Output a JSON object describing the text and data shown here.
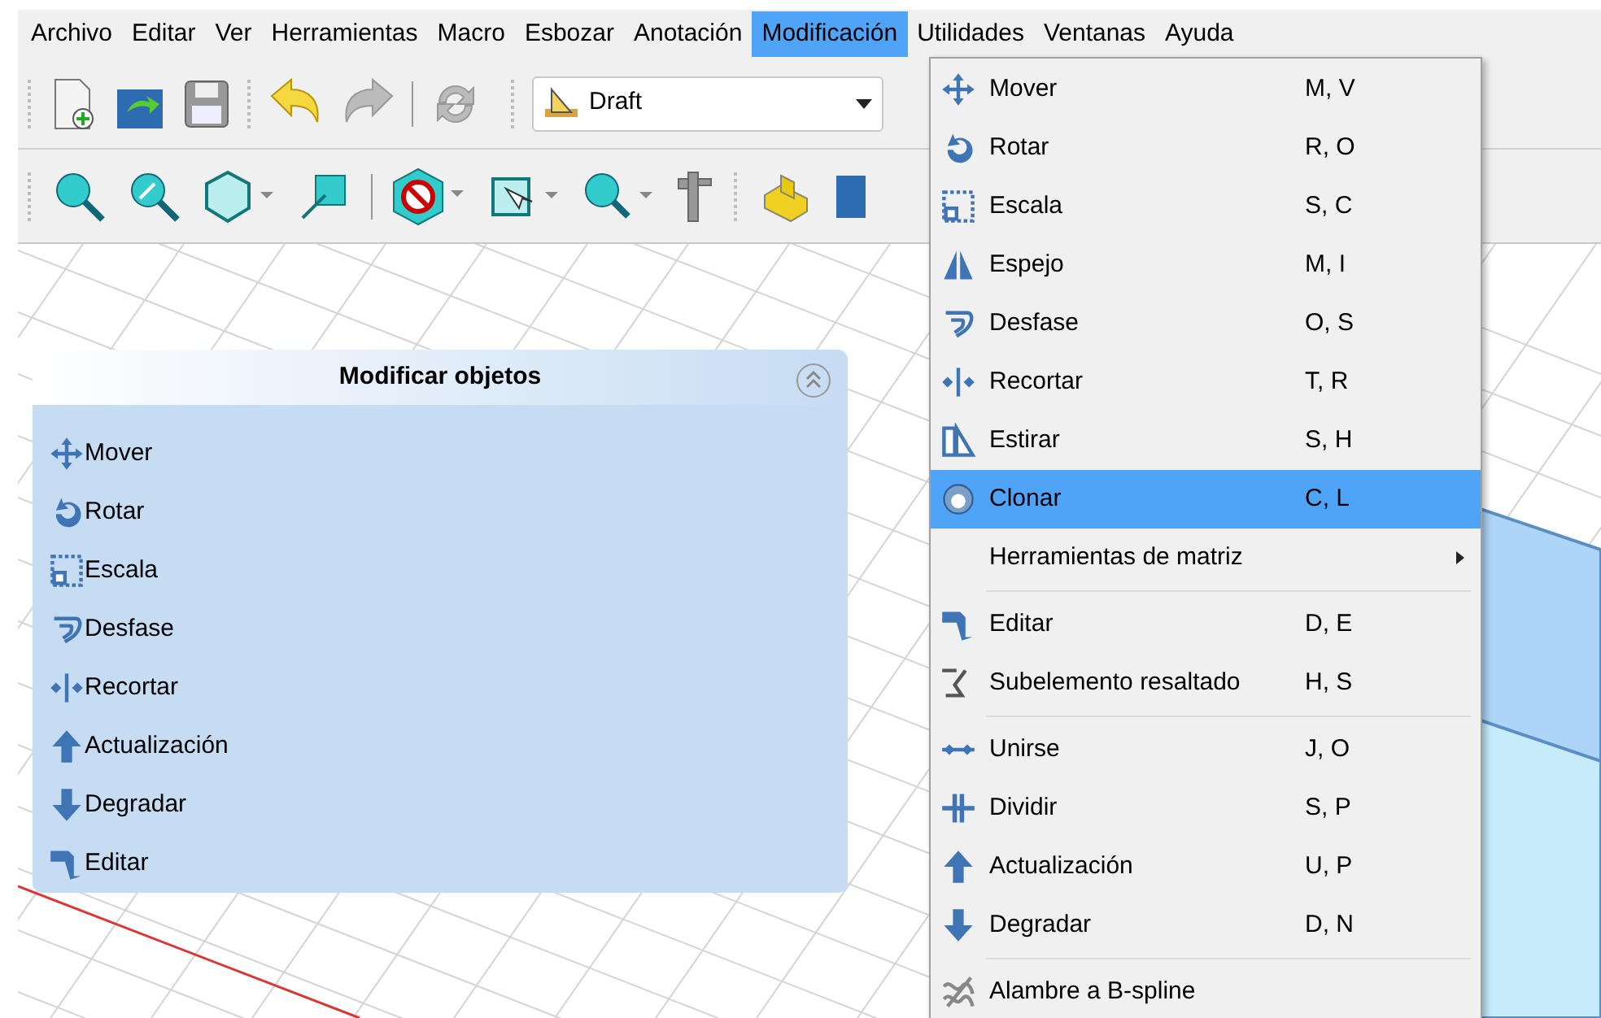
{
  "menubar": [
    {
      "label": "Archivo",
      "selected": false
    },
    {
      "label": "Editar",
      "selected": false
    },
    {
      "label": "Ver",
      "selected": false
    },
    {
      "label": "Herramientas",
      "selected": false
    },
    {
      "label": "Macro",
      "selected": false
    },
    {
      "label": "Esbozar",
      "selected": false
    },
    {
      "label": "Anotación",
      "selected": false
    },
    {
      "label": "Modificación",
      "selected": true
    },
    {
      "label": "Utilidades",
      "selected": false
    },
    {
      "label": "Ventanas",
      "selected": false
    },
    {
      "label": "Ayuda",
      "selected": false
    }
  ],
  "workbench_selector": {
    "value": "Draft"
  },
  "task_panel": {
    "title": "Modificar objetos",
    "items": [
      "Mover",
      "Rotar",
      "Escala",
      "Desfase",
      "Recortar",
      "Actualización",
      "Degradar",
      "Editar"
    ]
  },
  "dropdown_menu": {
    "items": [
      {
        "kind": "item",
        "label": "Mover",
        "shortcut": "M, V",
        "selected": false
      },
      {
        "kind": "item",
        "label": "Rotar",
        "shortcut": "R, O",
        "selected": false
      },
      {
        "kind": "item",
        "label": "Escala",
        "shortcut": "S, C",
        "selected": false
      },
      {
        "kind": "item",
        "label": "Espejo",
        "shortcut": "M, I",
        "selected": false
      },
      {
        "kind": "item",
        "label": "Desfase",
        "shortcut": "O, S",
        "selected": false
      },
      {
        "kind": "item",
        "label": "Recortar",
        "shortcut": "T, R",
        "selected": false
      },
      {
        "kind": "item",
        "label": "Estirar",
        "shortcut": "S, H",
        "selected": false
      },
      {
        "kind": "item",
        "label": "Clonar",
        "shortcut": "C, L",
        "selected": true
      },
      {
        "kind": "submenu",
        "label": "Herramientas de matriz",
        "selected": false
      },
      {
        "kind": "separator"
      },
      {
        "kind": "item",
        "label": "Editar",
        "shortcut": "D, E",
        "selected": false
      },
      {
        "kind": "item",
        "label": "Subelemento resaltado",
        "shortcut": "H, S",
        "selected": false
      },
      {
        "kind": "separator"
      },
      {
        "kind": "item",
        "label": "Unirse",
        "shortcut": "J, O",
        "selected": false
      },
      {
        "kind": "item",
        "label": "Dividir",
        "shortcut": "S, P",
        "selected": false
      },
      {
        "kind": "item",
        "label": "Actualización",
        "shortcut": "U, P",
        "selected": false
      },
      {
        "kind": "item",
        "label": "Degradar",
        "shortcut": "D, N",
        "selected": false
      },
      {
        "kind": "separator"
      },
      {
        "kind": "item",
        "label": "Alambre a B-spline",
        "selected": false
      }
    ]
  }
}
